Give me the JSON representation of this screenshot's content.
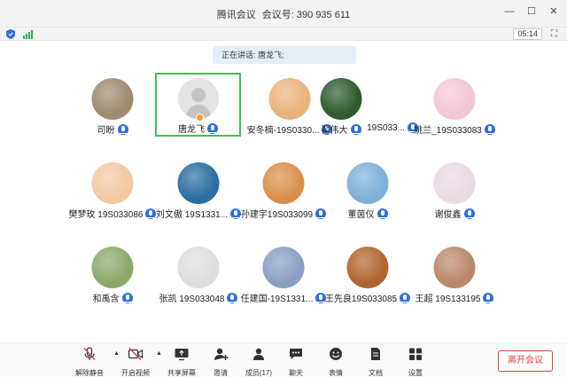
{
  "window": {
    "app_name": "腾讯会议",
    "meeting_label": "会议号:",
    "meeting_id": "390 935 611",
    "timer": "05:14"
  },
  "speaking": {
    "text": "正在讲话: 唐龙飞;"
  },
  "active_participant": {
    "name": "唐龙飞"
  },
  "participants": [
    {
      "name": "司盼",
      "avatar_color": "#9c8b6e"
    },
    {
      "name": "安冬楠-19S0330...",
      "avatar_color": "#e8b37a"
    },
    {
      "name": "翟伟大",
      "avatar_color": "#2e5a2e"
    },
    {
      "name": "19S033...",
      "avatar_color": "#2e5a2e"
    },
    {
      "name": "姚兰_19S033083",
      "avatar_color": "#f3c6d6"
    },
    {
      "name": "樊梦玫 19S033086",
      "avatar_color": "#f2c9a3"
    },
    {
      "name": "刘文傲 19S1331...",
      "avatar_color": "#2a6ea0"
    },
    {
      "name": "孙建宇19S033099",
      "avatar_color": "#d98f4a"
    },
    {
      "name": "董茵仪",
      "avatar_color": "#7fb0d9"
    },
    {
      "name": "谢俊鑫",
      "avatar_color": "#e9d9e3"
    },
    {
      "name": "和禹含",
      "avatar_color": "#8aa86a"
    },
    {
      "name": "张凯 19S033048",
      "avatar_color": "#dddddd"
    },
    {
      "name": "任建国-19S1331...",
      "avatar_color": "#8a9fc4"
    },
    {
      "name": "王先良19S033085",
      "avatar_color": "#b0652e"
    },
    {
      "name": "王超 19S133195",
      "avatar_color": "#b9876a"
    }
  ],
  "toolbar": {
    "unmute": "解除静音",
    "video": "开启视频",
    "share": "共享屏幕",
    "invite": "邀请",
    "members": "成员(17)",
    "chat": "聊天",
    "reactions": "表情",
    "docs": "文档",
    "settings": "设置",
    "leave": "离开会议"
  }
}
